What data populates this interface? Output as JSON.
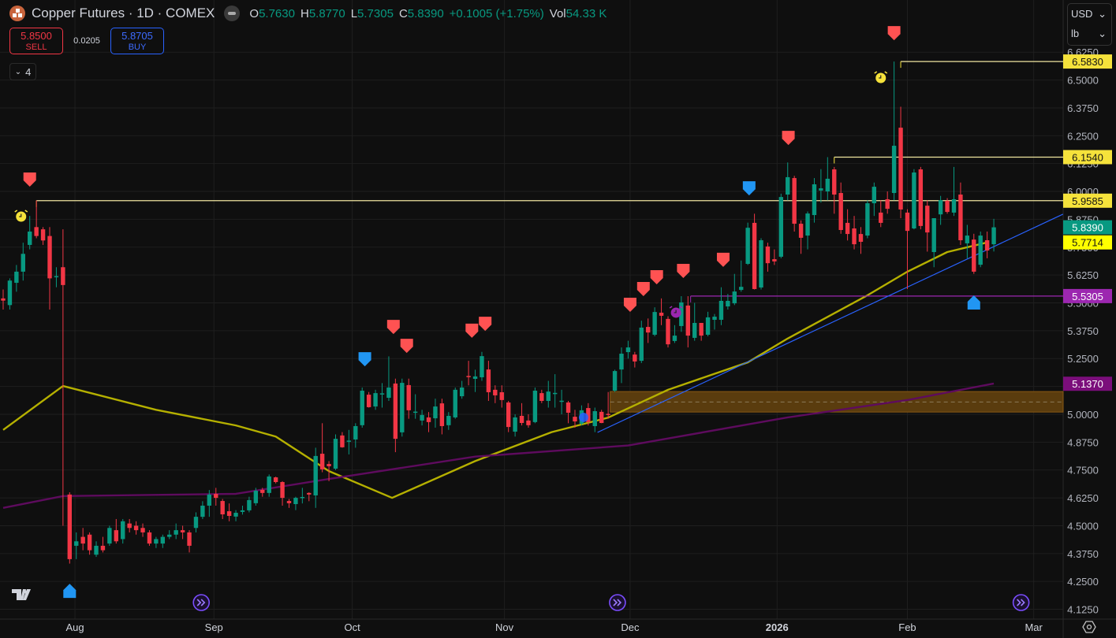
{
  "header": {
    "title": "Copper Futures · 1D · COMEX",
    "ohlc": [
      {
        "key": "O",
        "value": "5.7630"
      },
      {
        "key": "H",
        "value": "5.8770"
      },
      {
        "key": "L",
        "value": "5.7305"
      },
      {
        "key": "C",
        "value": "5.8390"
      }
    ],
    "change": "+0.1005 (+1.75%)",
    "vol_label": "Vol",
    "vol_value": "54.33 K"
  },
  "trade": {
    "sell_price": "5.8500",
    "sell_label": "SELL",
    "spread": "0.0205",
    "buy_price": "5.8705",
    "buy_label": "BUY"
  },
  "indicators_collapsed_count": "4",
  "currency": {
    "currency": "USD",
    "unit": "lb"
  },
  "colors": {
    "up": "#089981",
    "down": "#f23645",
    "ma_fast": "#b5b000",
    "ma_slow": "#5e0b5e",
    "trendline": "#2962ff",
    "zone": "#5a3c0e"
  },
  "chart_data": {
    "type": "candlestick",
    "title": "Copper Futures · 1D · COMEX",
    "ylim": [
      4.081,
      6.859
    ],
    "y_ticks": [
      "6.6250",
      "6.5000",
      "6.3750",
      "6.2500",
      "6.1250",
      "6.0000",
      "5.8750",
      "5.7500",
      "5.6250",
      "5.5000",
      "5.3750",
      "5.2500",
      "5.1250",
      "5.0000",
      "4.8750",
      "4.7500",
      "4.6250",
      "4.5000",
      "4.3750",
      "4.2500",
      "4.1250"
    ],
    "x_labels": [
      {
        "label": "Aug",
        "at": 10.8,
        "bold": false
      },
      {
        "label": "Sep",
        "at": 31.7,
        "bold": false
      },
      {
        "label": "Oct",
        "at": 52.5,
        "bold": false
      },
      {
        "label": "Nov",
        "at": 75.4,
        "bold": false
      },
      {
        "label": "Dec",
        "at": 94.3,
        "bold": false
      },
      {
        "label": "2026",
        "at": 116.4,
        "bold": true
      },
      {
        "label": "Feb",
        "at": 136.0,
        "bold": false
      },
      {
        "label": "Mar",
        "at": 155.0,
        "bold": false
      }
    ],
    "candles_ohlc": [
      [
        5.52,
        5.56,
        5.47,
        5.51
      ],
      [
        5.49,
        5.61,
        5.47,
        5.6
      ],
      [
        5.59,
        5.67,
        5.55,
        5.64
      ],
      [
        5.64,
        5.77,
        5.6,
        5.72
      ],
      [
        5.76,
        5.89,
        5.74,
        5.82
      ],
      [
        5.84,
        5.96,
        5.79,
        5.8
      ],
      [
        5.83,
        5.84,
        5.76,
        5.78
      ],
      [
        5.8,
        5.84,
        5.47,
        5.61
      ],
      [
        5.62,
        5.66,
        5.57,
        5.62
      ],
      [
        5.66,
        5.83,
        4.5,
        5.58
      ],
      [
        4.64,
        4.65,
        4.33,
        4.35
      ],
      [
        4.41,
        4.47,
        4.35,
        4.43
      ],
      [
        4.45,
        4.49,
        4.39,
        4.42
      ],
      [
        4.46,
        4.47,
        4.37,
        4.39
      ],
      [
        4.37,
        4.43,
        4.36,
        4.41
      ],
      [
        4.41,
        4.45,
        4.38,
        4.39
      ],
      [
        4.42,
        4.5,
        4.41,
        4.49
      ],
      [
        4.48,
        4.53,
        4.42,
        4.43
      ],
      [
        4.44,
        4.53,
        4.42,
        4.52
      ],
      [
        4.51,
        4.53,
        4.47,
        4.49
      ],
      [
        4.5,
        4.52,
        4.46,
        4.48
      ],
      [
        4.49,
        4.51,
        4.45,
        4.47
      ],
      [
        4.47,
        4.48,
        4.41,
        4.42
      ],
      [
        4.42,
        4.45,
        4.4,
        4.44
      ],
      [
        4.42,
        4.46,
        4.4,
        4.45
      ],
      [
        4.45,
        4.48,
        4.44,
        4.46
      ],
      [
        4.46,
        4.51,
        4.44,
        4.48
      ],
      [
        4.48,
        4.5,
        4.44,
        4.47
      ],
      [
        4.47,
        4.48,
        4.38,
        4.41
      ],
      [
        4.49,
        4.56,
        4.47,
        4.54
      ],
      [
        4.54,
        4.61,
        4.53,
        4.59
      ],
      [
        4.59,
        4.66,
        4.54,
        4.64
      ],
      [
        4.643,
        4.67,
        4.59,
        4.625
      ],
      [
        4.611,
        4.62,
        4.53,
        4.551
      ],
      [
        4.565,
        4.6,
        4.52,
        4.544
      ],
      [
        4.541,
        4.57,
        4.52,
        4.558
      ],
      [
        4.562,
        4.59,
        4.55,
        4.569
      ],
      [
        4.569,
        4.63,
        4.56,
        4.615
      ],
      [
        4.601,
        4.67,
        4.59,
        4.657
      ],
      [
        4.661,
        4.67,
        4.63,
        4.647
      ],
      [
        4.647,
        4.73,
        4.63,
        4.721
      ],
      [
        4.717,
        4.72,
        4.69,
        4.696
      ],
      [
        4.696,
        4.7,
        4.59,
        4.625
      ],
      [
        4.611,
        4.62,
        4.58,
        4.601
      ],
      [
        4.597,
        4.63,
        4.57,
        4.625
      ],
      [
        4.627,
        4.67,
        4.6,
        4.629
      ],
      [
        4.647,
        4.65,
        4.61,
        4.64
      ],
      [
        4.636,
        4.85,
        4.58,
        4.813
      ],
      [
        4.823,
        4.96,
        4.74,
        4.753
      ],
      [
        4.777,
        4.79,
        4.7,
        4.767
      ],
      [
        4.756,
        4.91,
        4.75,
        4.89
      ],
      [
        4.905,
        4.92,
        4.85,
        4.852
      ],
      [
        4.878,
        4.93,
        4.82,
        4.882
      ],
      [
        4.887,
        4.96,
        4.85,
        4.947
      ],
      [
        4.951,
        5.12,
        4.94,
        5.106
      ],
      [
        5.088,
        5.1,
        5.03,
        5.032
      ],
      [
        5.035,
        5.11,
        5.02,
        5.095
      ],
      [
        5.09,
        5.14,
        5.03,
        5.094
      ],
      [
        5.074,
        5.26,
        5.06,
        5.12
      ],
      [
        5.138,
        5.16,
        4.83,
        4.89
      ],
      [
        4.919,
        5.16,
        4.9,
        5.141
      ],
      [
        5.131,
        5.16,
        4.98,
        5.018
      ],
      [
        5.008,
        5.09,
        4.98,
        5.012
      ],
      [
        4.972,
        5.02,
        4.95,
        4.997
      ],
      [
        4.986,
        5.01,
        4.92,
        4.965
      ],
      [
        4.982,
        5.07,
        4.94,
        5.035
      ],
      [
        5.049,
        5.07,
        4.91,
        4.947
      ],
      [
        4.951,
        5.01,
        4.93,
        4.993
      ],
      [
        4.986,
        5.12,
        4.98,
        5.11
      ],
      [
        5.081,
        5.15,
        5.07,
        5.12
      ],
      [
        5.172,
        5.24,
        5.13,
        5.168
      ],
      [
        5.159,
        5.2,
        5.1,
        5.17
      ],
      [
        5.166,
        5.28,
        5.15,
        5.261
      ],
      [
        5.201,
        5.24,
        5.06,
        5.099
      ],
      [
        5.11,
        5.13,
        5.05,
        5.085
      ],
      [
        5.099,
        5.13,
        5.03,
        5.064
      ],
      [
        5.053,
        5.06,
        4.92,
        4.943
      ],
      [
        4.922,
        5.0,
        4.9,
        4.986
      ],
      [
        4.993,
        5.05,
        4.95,
        4.961
      ],
      [
        4.972,
        5.0,
        4.94,
        4.951
      ],
      [
        4.965,
        5.12,
        4.96,
        5.106
      ],
      [
        5.095,
        5.11,
        5.05,
        5.06
      ],
      [
        5.06,
        5.15,
        5.03,
        5.102
      ],
      [
        5.094,
        5.18,
        5.03,
        5.096
      ],
      [
        5.058,
        5.11,
        5.0,
        5.061
      ],
      [
        5.053,
        5.06,
        4.96,
        5.007
      ],
      [
        4.989,
        5.02,
        4.94,
        4.968
      ],
      [
        4.958,
        5.04,
        4.95,
        5.018
      ],
      [
        5.028,
        5.05,
        4.95,
        4.965
      ],
      [
        4.947,
        5.03,
        4.92,
        5.014
      ],
      [
        5.011,
        5.02,
        4.96,
        4.961
      ],
      [
        5.002,
        5.1,
        4.98,
        4.999
      ],
      [
        5.106,
        5.2,
        5.1,
        5.194
      ],
      [
        5.201,
        5.3,
        5.14,
        5.272
      ],
      [
        5.279,
        5.33,
        5.25,
        5.3
      ],
      [
        5.268,
        5.28,
        5.21,
        5.237
      ],
      [
        5.24,
        5.42,
        5.23,
        5.389
      ],
      [
        5.392,
        5.43,
        5.32,
        5.367
      ],
      [
        5.357,
        5.48,
        5.35,
        5.459
      ],
      [
        5.456,
        5.52,
        5.4,
        5.442
      ],
      [
        5.428,
        5.44,
        5.3,
        5.314
      ],
      [
        5.329,
        5.4,
        5.32,
        5.353
      ],
      [
        5.396,
        5.53,
        5.37,
        5.502
      ],
      [
        5.488,
        5.53,
        5.3,
        5.353
      ],
      [
        5.343,
        5.5,
        5.33,
        5.41
      ],
      [
        5.41,
        5.41,
        5.33,
        5.353
      ],
      [
        5.357,
        5.46,
        5.35,
        5.435
      ],
      [
        5.424,
        5.45,
        5.38,
        5.438
      ],
      [
        5.424,
        5.57,
        5.4,
        5.509
      ],
      [
        5.484,
        5.54,
        5.47,
        5.509
      ],
      [
        5.498,
        5.63,
        5.49,
        5.551
      ],
      [
        5.558,
        5.69,
        5.55,
        5.572
      ],
      [
        5.675,
        5.86,
        5.67,
        5.837
      ],
      [
        5.859,
        5.9,
        5.56,
        5.562
      ],
      [
        5.569,
        5.79,
        5.56,
        5.781
      ],
      [
        5.753,
        5.77,
        5.64,
        5.678
      ],
      [
        5.696,
        5.74,
        5.67,
        5.686
      ],
      [
        5.707,
        5.99,
        5.7,
        5.975
      ],
      [
        5.986,
        6.13,
        5.96,
        6.064
      ],
      [
        6.06,
        6.07,
        5.82,
        5.855
      ],
      [
        5.855,
        5.87,
        5.72,
        5.792
      ],
      [
        5.802,
        5.91,
        5.74,
        5.901
      ],
      [
        5.894,
        6.06,
        5.86,
        6.032
      ],
      [
        6.004,
        6.1,
        5.95,
        6.014
      ],
      [
        6.0,
        6.154,
        5.96,
        6.057
      ],
      [
        6.099,
        6.11,
        5.9,
        5.986
      ],
      [
        5.993,
        6.04,
        5.81,
        5.827
      ],
      [
        5.859,
        5.92,
        5.78,
        5.809
      ],
      [
        5.834,
        5.89,
        5.74,
        5.763
      ],
      [
        5.809,
        5.84,
        5.72,
        5.774
      ],
      [
        5.802,
        5.96,
        5.79,
        5.947
      ],
      [
        5.947,
        6.04,
        5.89,
        6.021
      ],
      [
        5.905,
        5.96,
        5.84,
        5.859
      ],
      [
        5.965,
        6.0,
        5.9,
        5.922
      ],
      [
        5.993,
        6.583,
        5.96,
        6.205
      ],
      [
        6.286,
        6.38,
        5.88,
        5.919
      ],
      [
        5.905,
        5.92,
        5.562,
        5.823
      ],
      [
        5.834,
        6.1,
        5.83,
        6.085
      ],
      [
        6.099,
        6.11,
        5.83,
        5.845
      ],
      [
        5.936,
        5.96,
        5.73,
        5.816
      ],
      [
        5.728,
        5.88,
        5.66,
        5.88
      ],
      [
        5.897,
        5.98,
        5.85,
        5.961
      ],
      [
        5.958,
        5.97,
        5.9,
        5.908
      ],
      [
        5.905,
        6.11,
        5.89,
        5.965
      ],
      [
        5.986,
        6.04,
        5.76,
        5.781
      ],
      [
        5.767,
        5.85,
        5.7,
        5.802
      ],
      [
        5.784,
        5.81,
        5.63,
        5.64
      ],
      [
        5.671,
        5.82,
        5.66,
        5.802
      ],
      [
        5.781,
        5.82,
        5.7,
        5.735
      ],
      [
        5.763,
        5.877,
        5.7305,
        5.839
      ]
    ],
    "moving_averages": [
      {
        "color": "#b5b000",
        "points": [
          [
            0,
            4.93
          ],
          [
            9,
            5.127
          ],
          [
            23,
            5.02
          ],
          [
            35,
            4.95
          ],
          [
            41,
            4.9
          ],
          [
            49,
            4.745
          ],
          [
            58.5,
            4.625
          ],
          [
            71,
            4.79
          ],
          [
            82.5,
            4.92
          ],
          [
            91,
            4.985
          ],
          [
            100,
            5.11
          ],
          [
            112,
            5.233
          ],
          [
            118,
            5.34
          ],
          [
            130,
            5.534
          ],
          [
            136,
            5.64
          ],
          [
            142,
            5.728
          ],
          [
            148,
            5.771
          ]
        ]
      },
      {
        "color": "#5e0b5e",
        "points": [
          [
            0,
            4.58
          ],
          [
            9,
            4.633
          ],
          [
            35,
            4.643
          ],
          [
            49,
            4.71
          ],
          [
            71,
            4.81
          ],
          [
            94,
            4.86
          ],
          [
            118,
            4.986
          ],
          [
            136,
            5.064
          ],
          [
            149,
            5.138
          ]
        ]
      }
    ],
    "trendline": {
      "from": [
        89.4,
        4.919
      ],
      "to": [
        159.4,
        5.898
      ]
    },
    "horizontal_levels": [
      {
        "price": 6.583,
        "from": 135,
        "label": "6.5830",
        "color": "#f5e23b",
        "text": "#131313"
      },
      {
        "price": 6.154,
        "from": 125,
        "label": "6.1540",
        "color": "#f5e23b",
        "text": "#131313"
      },
      {
        "price": 5.9585,
        "from": 5,
        "label": "5.9585",
        "color": "#f5e23b",
        "text": "#131313"
      },
      {
        "price": 5.5305,
        "from": 103.4,
        "label": "5.5305",
        "color": "#9c27b0",
        "text": "#ffffff"
      }
    ],
    "price_tags": [
      {
        "price": 5.839,
        "label": "5.8390",
        "color": "#089981",
        "text": "#ffffff"
      },
      {
        "price": 5.7714,
        "label": "5.7714",
        "color": "#ffff00",
        "text": "#131313"
      },
      {
        "price": 5.137,
        "label": "5.1370",
        "color": "#7b0e7b",
        "text": "#ffffff"
      }
    ],
    "zone": {
      "from": 91.3,
      "top": 5.102,
      "bottom": 5.01,
      "mid": 5.055
    },
    "markers": [
      {
        "type": "flag-down",
        "color": "#ff5252",
        "at": 4,
        "price": 6.053
      },
      {
        "type": "flag-down",
        "color": "#ff5252",
        "at": 58.7,
        "price": 5.392
      },
      {
        "type": "flag-down",
        "color": "#ff5252",
        "at": 60.7,
        "price": 5.307
      },
      {
        "type": "flag-down",
        "color": "#ff5252",
        "at": 70.5,
        "price": 5.375
      },
      {
        "type": "flag-down",
        "color": "#ff5252",
        "at": 72.5,
        "price": 5.406
      },
      {
        "type": "flag-down",
        "color": "#ff5252",
        "at": 94.3,
        "price": 5.491
      },
      {
        "type": "flag-down",
        "color": "#ff5252",
        "at": 96.3,
        "price": 5.562
      },
      {
        "type": "flag-down",
        "color": "#ff5252",
        "at": 98.3,
        "price": 5.615
      },
      {
        "type": "flag-down",
        "color": "#ff5252",
        "at": 102.3,
        "price": 5.643
      },
      {
        "type": "flag-down",
        "color": "#ff5252",
        "at": 108.3,
        "price": 5.693
      },
      {
        "type": "flag-down",
        "color": "#ff5252",
        "at": 118.1,
        "price": 6.24
      },
      {
        "type": "flag-down",
        "color": "#ff5252",
        "at": 134,
        "price": 6.71
      },
      {
        "type": "flag-down",
        "color": "#2196f3",
        "at": 54.4,
        "price": 5.247
      },
      {
        "type": "flag-down",
        "color": "#2196f3",
        "at": 112.2,
        "price": 6.014
      },
      {
        "type": "flag-up",
        "color": "#2196f3",
        "at": 10,
        "price": 4.208
      },
      {
        "type": "flag-up",
        "color": "#2196f3",
        "at": 146,
        "price": 5.502
      },
      {
        "type": "alarm",
        "color": "#f5e23b",
        "at": 2.7,
        "price": 5.887
      },
      {
        "type": "alarm",
        "color": "#f5e23b",
        "at": 132,
        "price": 6.509
      },
      {
        "type": "alarm",
        "color": "#9c27b0",
        "at": 101.2,
        "price": 5.456
      },
      {
        "type": "dot",
        "color": "#2962ff",
        "at": 87.3,
        "price": 4.986
      }
    ],
    "replay_icons_at": [
      29.8,
      92.4,
      153.1
    ]
  }
}
